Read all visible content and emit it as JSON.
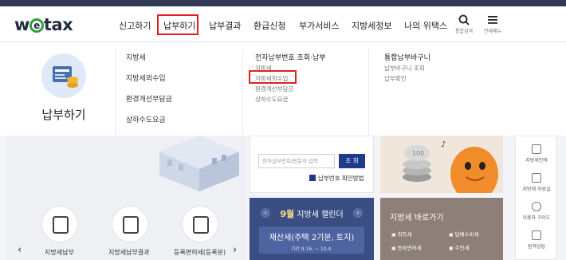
{
  "header": {
    "logo_text": "wetax",
    "nav": [
      {
        "label": "신고하기"
      },
      {
        "label": "납부하기"
      },
      {
        "label": "납부결과"
      },
      {
        "label": "환급신청"
      },
      {
        "label": "부가서비스"
      },
      {
        "label": "지방세정보"
      },
      {
        "label": "나의 위택스"
      }
    ],
    "search_label": "통합검색",
    "menu_label": "전체메뉴"
  },
  "mega_menu": {
    "category_title": "납부하기",
    "col1": [
      "지방세",
      "지방세외수입",
      "환경개선부담금",
      "상하수도요금"
    ],
    "col2": {
      "heading": "전자납부번호 조회·납부",
      "items": [
        "지방세",
        "지방세외수입",
        "환경개선부담금",
        "상하수도요금"
      ]
    },
    "col3": {
      "heading": "통합납부바구니",
      "items": [
        "납부바구니 조회",
        "납부확인"
      ]
    }
  },
  "search_panel": {
    "placeholder": "전자납부번호/방문자 입력",
    "button": "조 회",
    "confirm_link": "납부번호 확인방법"
  },
  "calendar": {
    "month": "9월",
    "title_suffix": " 지방세 캘린더",
    "event_title": "재산세(주택 2기분, 토지)",
    "event_period": "기간 9.16. ~ 10.4."
  },
  "shortcut": {
    "title": "지방세 바로가기",
    "items": [
      "취득세",
      "담배소비세",
      "등록면허세",
      "주민세"
    ]
  },
  "side_bar": {
    "items": [
      "지방세인덱",
      "지방세 자료실",
      "이용자 가이드",
      "원격상담"
    ]
  },
  "quick_links": [
    "지방세납부",
    "지방세납부결과",
    "등록면허세(등록분)"
  ],
  "colors": {
    "topbar": "#2e3a55",
    "highlight": "#e02020",
    "calendar_bg": "#3a4e84",
    "shortcut_bg": "#8e7f78",
    "button_bg": "#1f3a8a"
  }
}
